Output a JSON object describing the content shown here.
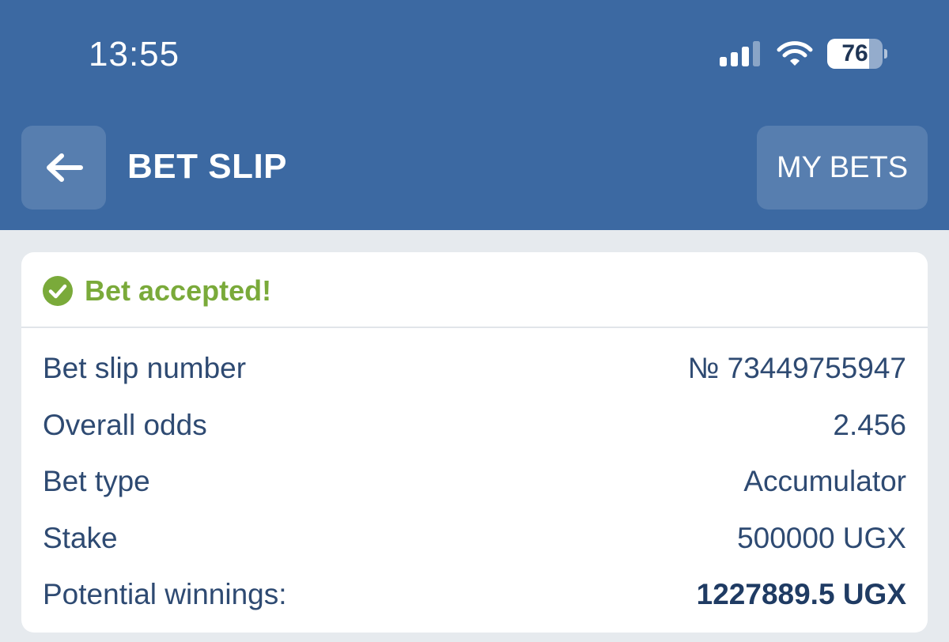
{
  "status_bar": {
    "time": "13:55",
    "battery_level": "76",
    "battery_percent": 76,
    "icons": [
      "signal-icon",
      "wifi-icon",
      "battery-icon"
    ]
  },
  "nav": {
    "back_icon": "arrow-left-icon",
    "title": "BET SLIP",
    "my_bets_label": "MY BETS"
  },
  "receipt": {
    "status_icon": "check-circle-icon",
    "status_text": "Bet accepted!",
    "rows": [
      {
        "label": "Bet slip number",
        "value": "№ 73449755947"
      },
      {
        "label": "Overall odds",
        "value": "2.456"
      },
      {
        "label": "Bet type",
        "value": "Accumulator"
      },
      {
        "label": "Stake",
        "value": "500000 UGX"
      },
      {
        "label": "Potential winnings:",
        "value": "1227889.5 UGX"
      }
    ]
  },
  "colors": {
    "header_bg": "#3c69a2",
    "page_bg": "#e6eaee",
    "success": "#7aaa3a",
    "text": "#2e4a72"
  }
}
